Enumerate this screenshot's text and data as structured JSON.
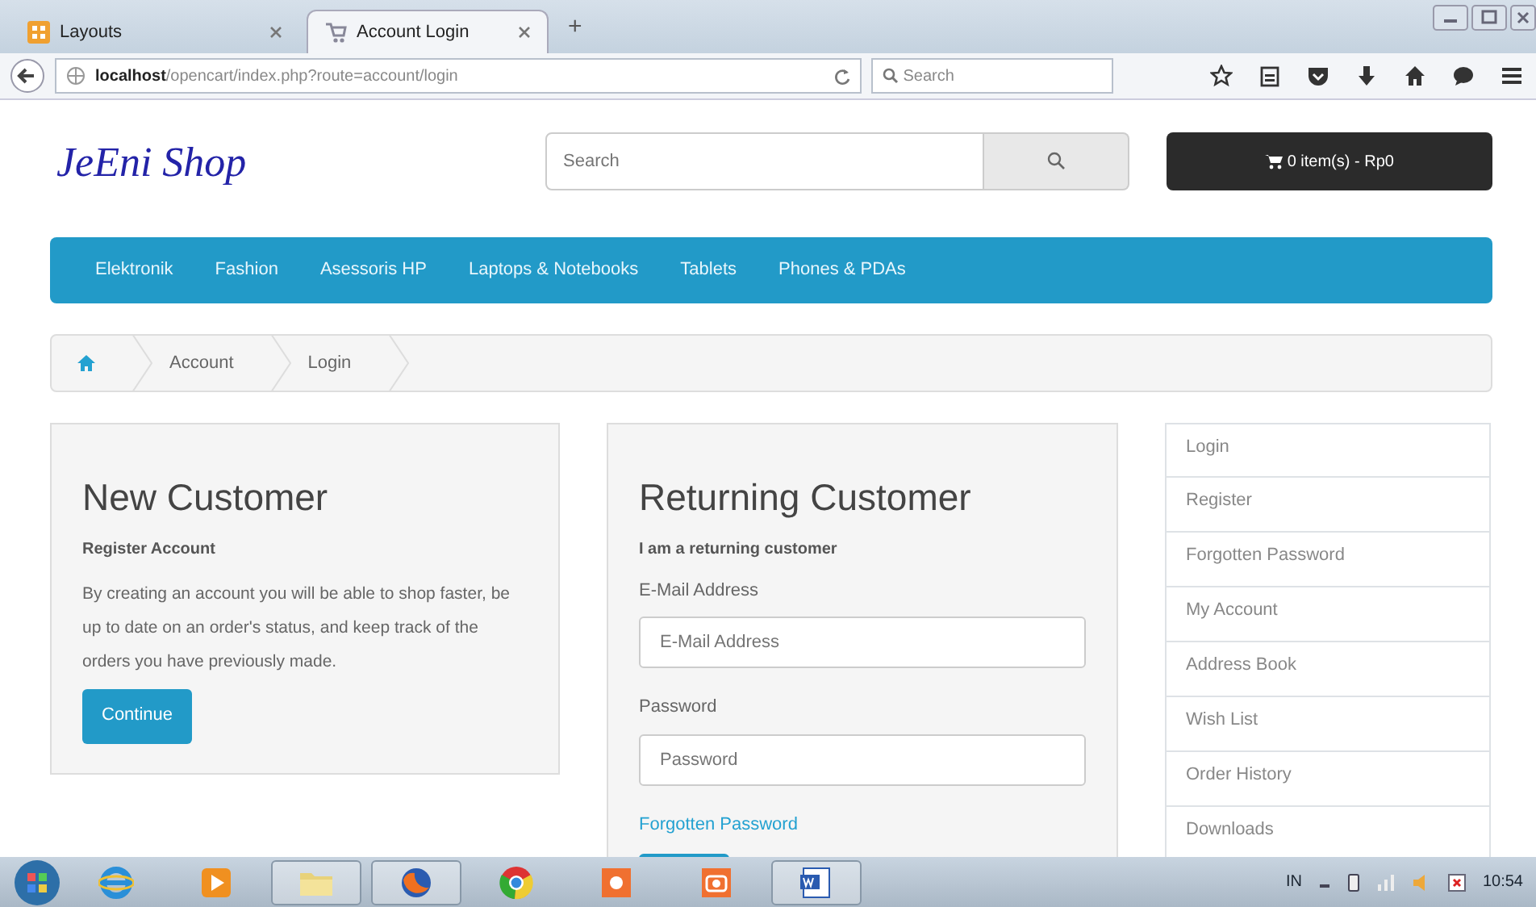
{
  "browser": {
    "tabs": [
      {
        "title": "Layouts",
        "selected": false,
        "kind": "grid"
      },
      {
        "title": "Account Login",
        "selected": true,
        "kind": "cart"
      }
    ],
    "new_tab": "+",
    "url_host": "localhost",
    "url_path": "/opencart/index.php?route=account/login",
    "search_placeholder": "Search"
  },
  "header": {
    "logo": "JeEni Shop",
    "search_placeholder": "Search",
    "cart": "0 item(s) - Rp0"
  },
  "menu": [
    "Elektronik",
    "Fashion",
    "Asessoris HP",
    "Laptops & Notebooks",
    "Tablets",
    "Phones & PDAs"
  ],
  "breadcrumb": [
    "Account",
    "Login"
  ],
  "new_customer": {
    "title": "New Customer",
    "subtitle": "Register Account",
    "text": "By creating an account you will be able to shop faster, be up to date on an order's status, and keep track of the orders you have previously made.",
    "button": "Continue"
  },
  "returning_customer": {
    "title": "Returning Customer",
    "subtitle": "I am a returning customer",
    "fields": [
      {
        "label": "E-Mail Address",
        "placeholder": "E-Mail Address"
      },
      {
        "label": "Password",
        "placeholder": "Password"
      }
    ],
    "link": "Forgotten Password"
  },
  "account_menu": [
    "Login",
    "Register",
    "Forgotten Password",
    "My Account",
    "Address Book",
    "Wish List",
    "Order History",
    "Downloads"
  ],
  "taskbar": {
    "apps": [
      {
        "kind": "ie",
        "open": false
      },
      {
        "kind": "media",
        "open": false
      },
      {
        "kind": "folder",
        "open": true
      },
      {
        "kind": "firefox",
        "open": true
      },
      {
        "kind": "chrome",
        "open": false
      },
      {
        "kind": "orange",
        "open": false
      },
      {
        "kind": "camera",
        "open": false
      },
      {
        "kind": "word",
        "open": true
      }
    ],
    "language": "IN",
    "clock": "10:54"
  }
}
